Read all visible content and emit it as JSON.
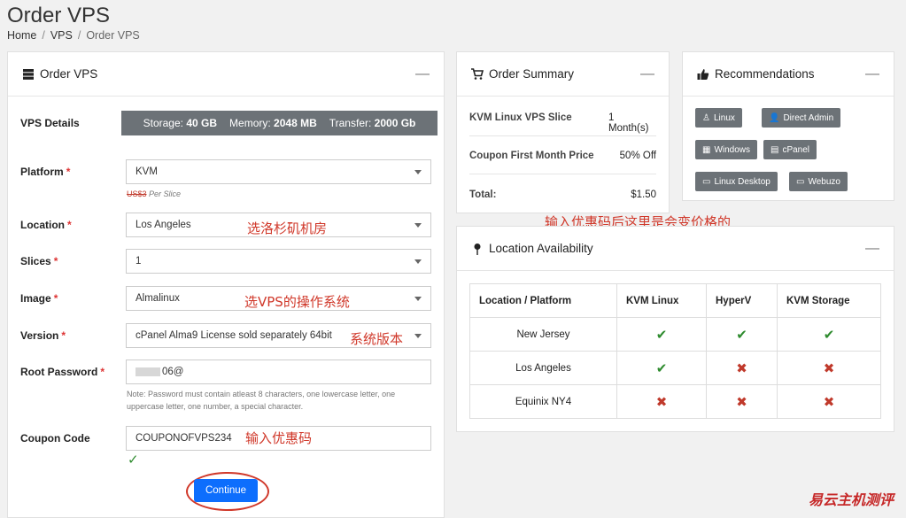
{
  "page": {
    "title": "Order VPS"
  },
  "breadcrumb": [
    "Home",
    "VPS",
    "Order VPS"
  ],
  "order": {
    "title": "Order VPS",
    "details_label": "VPS Details",
    "details": {
      "storage_label": "Storage:",
      "storage": "40 GB",
      "memory_label": "Memory:",
      "memory": "2048 MB",
      "transfer_label": "Transfer:",
      "transfer": "2000 Gb"
    },
    "platform_label": "Platform",
    "platform_value": "KVM",
    "price_old": "US$3",
    "price_suffix": "Per Slice",
    "location_label": "Location",
    "location_value": "Los Angeles",
    "slices_label": "Slices",
    "slices_value": "1",
    "image_label": "Image",
    "image_value": "Almalinux",
    "version_label": "Version",
    "version_value": "cPanel Alma9 License sold separately 64bit",
    "password_label": "Root Password",
    "password_value": "06@",
    "password_note": "Note: Password must contain atleast 8 characters, one lowercase letter, one uppercase letter, one number, a special character.",
    "coupon_label": "Coupon Code",
    "coupon_value": "COUPONOFVPS234",
    "continue_label": "Continue",
    "annotations": {
      "location": "选洛杉矶机房",
      "image": "选VPS的操作系统",
      "version": "系统版本",
      "coupon": "输入优惠码",
      "price": "输入优惠码后这里是会变价格的"
    }
  },
  "summary": {
    "title": "Order Summary",
    "rows": [
      {
        "label": "KVM Linux VPS Slice",
        "value": "1 Month(s)"
      },
      {
        "label": "Coupon First Month Price",
        "value": "50% Off"
      },
      {
        "label": "Total:",
        "value": "$1.50"
      }
    ]
  },
  "recommendations": {
    "title": "Recommendations",
    "items": [
      "Linux",
      "Direct Admin",
      "Windows",
      "cPanel",
      "Linux Desktop",
      "Webuzo"
    ]
  },
  "availability": {
    "title": "Location Availability",
    "columns": [
      "Location / Platform",
      "KVM Linux",
      "HyperV",
      "KVM Storage"
    ],
    "rows": [
      {
        "location": "New Jersey",
        "values": [
          true,
          true,
          true
        ]
      },
      {
        "location": "Los Angeles",
        "values": [
          true,
          false,
          false
        ]
      },
      {
        "location": "Equinix NY4",
        "values": [
          false,
          false,
          false
        ]
      }
    ]
  },
  "watermark": "易云主机测评",
  "colors": {
    "primary": "#0d6efd",
    "annotation": "#d0382a",
    "check": "#2e8b2e",
    "cross": "#c0392b"
  }
}
